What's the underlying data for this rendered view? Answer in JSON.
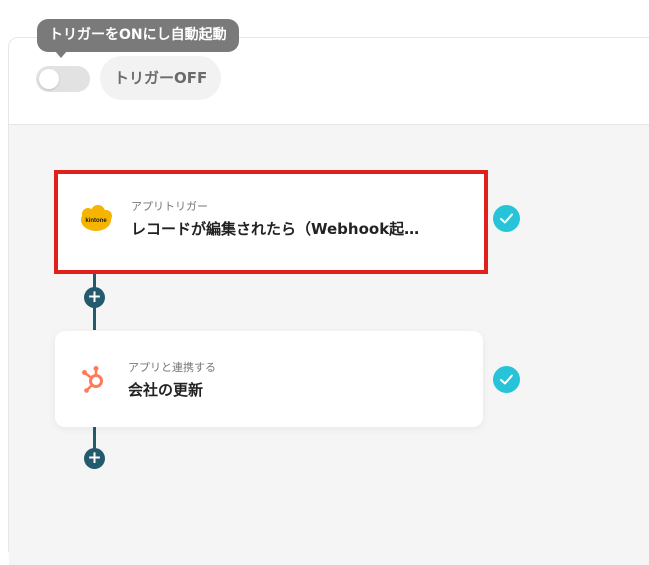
{
  "header": {
    "tooltip": "トリガーをONにし自動起動",
    "toggle_state": "off",
    "status_label": "トリガーOFF"
  },
  "steps": [
    {
      "type_label": "アプリトリガー",
      "title": "レコードが編集されたら（Webhook起…",
      "icon": "kintone-logo",
      "logo_text": "kintone",
      "status": "complete",
      "selected": true
    },
    {
      "type_label": "アプリと連携する",
      "title": "会社の更新",
      "icon": "hubspot-logo",
      "status": "complete",
      "selected": false
    }
  ],
  "colors": {
    "connector": "#245a6d",
    "check": "#27c4d9",
    "highlight": "#e0201c",
    "kintone": "#f5b400",
    "hubspot": "#ff7a59"
  }
}
